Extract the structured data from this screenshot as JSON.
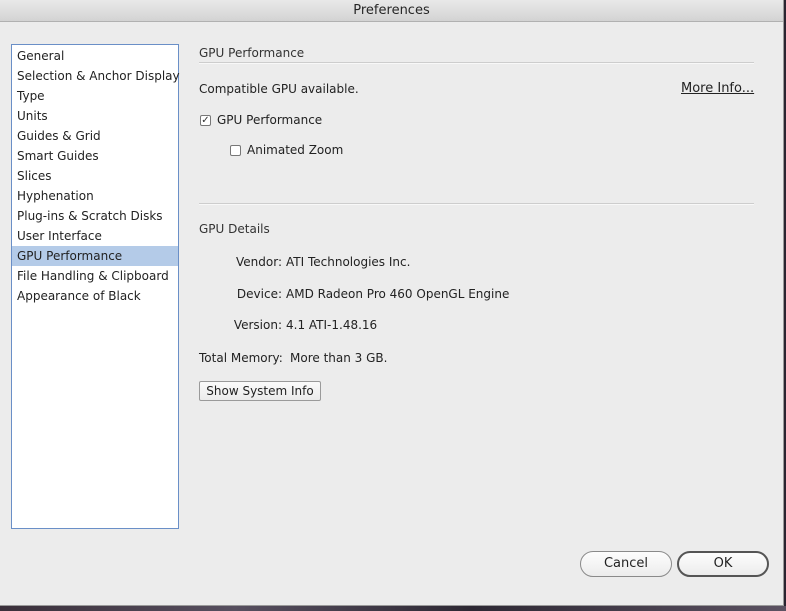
{
  "window": {
    "title": "Preferences"
  },
  "sidebar": {
    "items": [
      {
        "label": "General"
      },
      {
        "label": "Selection & Anchor Display"
      },
      {
        "label": "Type"
      },
      {
        "label": "Units"
      },
      {
        "label": "Guides & Grid"
      },
      {
        "label": "Smart Guides"
      },
      {
        "label": "Slices"
      },
      {
        "label": "Hyphenation"
      },
      {
        "label": "Plug-ins & Scratch Disks"
      },
      {
        "label": "User Interface"
      },
      {
        "label": "GPU Performance"
      },
      {
        "label": "File Handling & Clipboard"
      },
      {
        "label": "Appearance of Black"
      }
    ],
    "selected_index": 10
  },
  "panel": {
    "title": "GPU Performance",
    "compatible_text": "Compatible GPU available.",
    "more_info_label": "More Info...",
    "gpu_performance_checkbox": {
      "label": "GPU Performance",
      "checked": true,
      "mark": "✓"
    },
    "animated_zoom_checkbox": {
      "label": "Animated Zoom",
      "checked": false,
      "mark": ""
    }
  },
  "gpu_details": {
    "title": "GPU Details",
    "vendor_label": "Vendor:",
    "vendor_value": "ATI Technologies Inc.",
    "device_label": "Device:",
    "device_value": "AMD Radeon Pro 460 OpenGL Engine",
    "version_label": "Version:",
    "version_value": "4.1 ATI-1.48.16",
    "total_memory_label": "Total Memory:",
    "total_memory_value": "More than 3 GB.",
    "show_system_info_label": "Show System Info"
  },
  "footer": {
    "cancel_label": "Cancel",
    "ok_label": "OK"
  }
}
